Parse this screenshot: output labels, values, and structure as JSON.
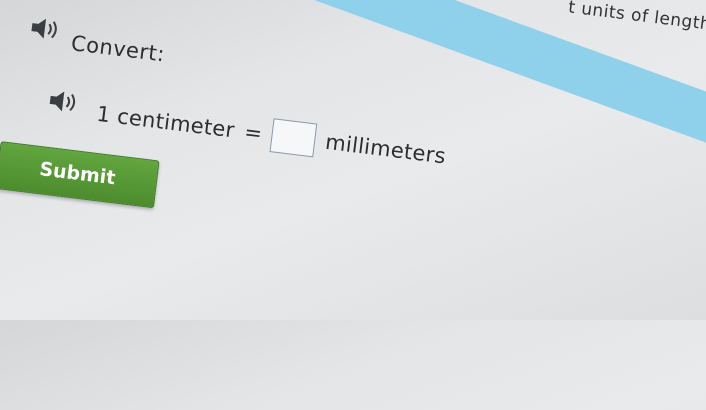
{
  "header": {
    "topic_partial": "t units of length"
  },
  "prompt": {
    "label": "Convert:",
    "speaker_icon": "speaker-icon"
  },
  "question": {
    "speaker_icon": "speaker-icon",
    "left_quantity": "1 centimeter",
    "equals": "=",
    "answer_value": "",
    "answer_placeholder": "",
    "unit": "millimeters"
  },
  "actions": {
    "submit_label": "Submit"
  },
  "colors": {
    "band": "#8fd0ea",
    "submit": "#58a038",
    "text": "#2b2e31"
  }
}
